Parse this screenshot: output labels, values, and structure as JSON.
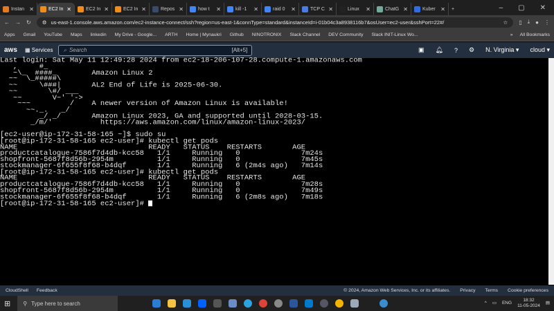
{
  "browser": {
    "tabs": [
      {
        "label": "Instan",
        "color": "#e07b20"
      },
      {
        "label": "EC2 In",
        "color": "#f08c1a",
        "active": true
      },
      {
        "label": "EC2 In",
        "color": "#f08c1a"
      },
      {
        "label": "EC2 In",
        "color": "#f08c1a"
      },
      {
        "label": "Repos",
        "color": "#3b4a6b"
      },
      {
        "label": "how t",
        "color": "#4285f4"
      },
      {
        "label": "kill -1",
        "color": "#4285f4"
      },
      {
        "label": "raid 0",
        "color": "#4285f4"
      },
      {
        "label": "TCP C",
        "color": "#4a7be0"
      },
      {
        "label": "Linux",
        "color": "#222"
      },
      {
        "label": "ChatG",
        "color": "#74aa9c"
      },
      {
        "label": "Kuber",
        "color": "#326ce5"
      }
    ],
    "url": "us-east-1.console.aws.amazon.com/ec2-instance-connect/ssh?region=us-east-1&connType=standard&instanceId=i-01b04c3a8938116b7&osUser=ec2-user&sshPort=22#/",
    "bookmarks": [
      "Apps",
      "Gmail",
      "YouTube",
      "Maps",
      "linkedin",
      "My Drive - Google...",
      "ARTH",
      "Home | Mynaukri",
      "Github",
      "NINOTRONIX",
      "Slack Channel",
      "DEV Community",
      "Slack INIT-Linux Wo..."
    ],
    "all_bookmarks": "All Bookmarks"
  },
  "aws": {
    "logo": "aws",
    "services": "Services",
    "search_placeholder": "Search",
    "search_shortcut": "[Alt+5]",
    "region": "N. Virginia ▾",
    "account": "cloud ▾"
  },
  "terminal": {
    "lines": [
      "Last login: Sat May 11 12:49:28 2024 from ec2-18-206-107-28.compute-1.amazonaws.com",
      "   ,     #_",
      "   ~\\_  ####_        Amazon Linux 2",
      "  ~~  \\_#####\\",
      "  ~~     \\###|       AL2 End of Life is 2025-06-30.",
      "  ~~       \\#/ ___",
      "   ~~       V~' '->",
      "    ~~~         /    A newer version of Amazon Linux is available!",
      "      ~~._.   _/",
      "         _/ _/       Amazon Linux 2023, GA and supported until 2028-03-15.",
      "       _/m/'           https://aws.amazon.com/linux/amazon-linux-2023/",
      "",
      "[ec2-user@ip-172-31-58-165 ~]$ sudo su",
      "[root@ip-172-31-58-165 ec2-user]# kubectl get pods",
      "NAME                              READY   STATUS    RESTARTS       AGE",
      "productcatalogue-7586f7d4db-kcc58   1/1     Running   0              7m24s",
      "shopfront-5687f8d56b-2954m          1/1     Running   0              7m45s",
      "stockmanager-6f655f8f68-b4dqf       1/1     Running   6 (2m4s ago)   7m14s",
      "[root@ip-172-31-58-165 ec2-user]# kubectl get pods",
      "NAME                              READY   STATUS    RESTARTS       AGE",
      "productcatalogue-7586f7d4db-kcc58   1/1     Running   0              7m28s",
      "shopfront-5687f8d56b-2954m          1/1     Running   0              7m49s",
      "stockmanager-6f655f8f68-b4dqf       1/1     Running   6 (2m8s ago)   7m18s"
    ],
    "prompt": "[root@ip-172-31-58-165 ec2-user]# "
  },
  "footer": {
    "cloudshell": "CloudShell",
    "feedback": "Feedback",
    "copyright": "© 2024, Amazon Web Services, Inc. or its affiliates.",
    "privacy": "Privacy",
    "terms": "Terms",
    "cookies": "Cookie preferences"
  },
  "taskbar": {
    "search_placeholder": "Type here to search",
    "lang": "ENG",
    "time": "18:32",
    "date": "11-05-2024"
  }
}
